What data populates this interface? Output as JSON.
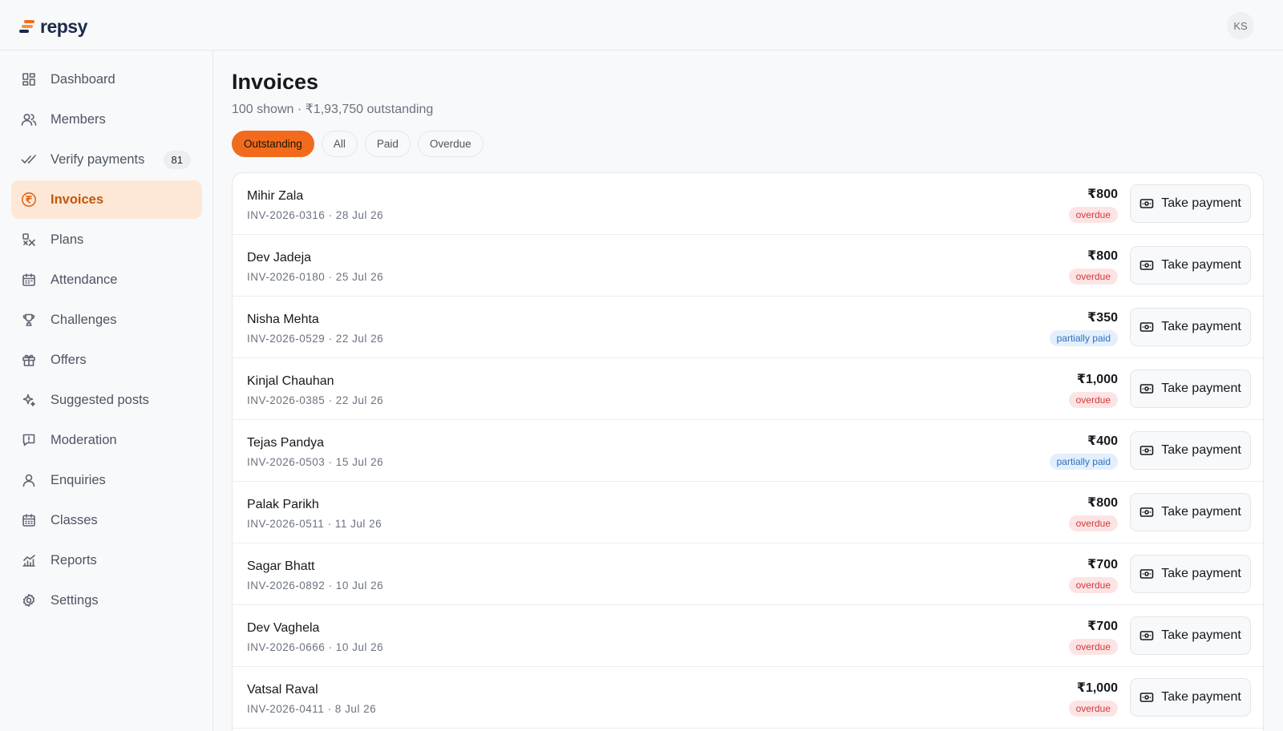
{
  "app": {
    "brand": "repsy",
    "user_initials": "KS"
  },
  "sidebar": {
    "items": [
      {
        "label": "Dashboard",
        "icon": "dashboard-icon"
      },
      {
        "label": "Members",
        "icon": "members-icon"
      },
      {
        "label": "Verify payments",
        "icon": "double-check-icon",
        "badge": "81"
      },
      {
        "label": "Invoices",
        "icon": "rupee-circle-icon",
        "active": true
      },
      {
        "label": "Plans",
        "icon": "plans-icon"
      },
      {
        "label": "Attendance",
        "icon": "calendar-icon"
      },
      {
        "label": "Challenges",
        "icon": "trophy-icon"
      },
      {
        "label": "Offers",
        "icon": "gift-icon"
      },
      {
        "label": "Suggested posts",
        "icon": "sparkles-icon"
      },
      {
        "label": "Moderation",
        "icon": "message-alert-icon"
      },
      {
        "label": "Enquiries",
        "icon": "user-icon"
      },
      {
        "label": "Classes",
        "icon": "calendar-grid-icon"
      },
      {
        "label": "Reports",
        "icon": "chart-icon"
      },
      {
        "label": "Settings",
        "icon": "gear-icon"
      }
    ]
  },
  "page": {
    "title": "Invoices",
    "subtitle": "100 shown · ₹1,93,750 outstanding"
  },
  "filters": [
    "Outstanding",
    "All",
    "Paid",
    "Overdue"
  ],
  "active_filter": "Outstanding",
  "action_label": "Take payment",
  "invoices": [
    {
      "name": "Mihir Zala",
      "meta": "INV-2026-0316 · 28 Jul 26",
      "amount": "₹800",
      "status": "overdue"
    },
    {
      "name": "Dev Jadeja",
      "meta": "INV-2026-0180 · 25 Jul 26",
      "amount": "₹800",
      "status": "overdue"
    },
    {
      "name": "Nisha Mehta",
      "meta": "INV-2026-0529 · 22 Jul 26",
      "amount": "₹350",
      "status": "partially paid"
    },
    {
      "name": "Kinjal Chauhan",
      "meta": "INV-2026-0385 · 22 Jul 26",
      "amount": "₹1,000",
      "status": "overdue"
    },
    {
      "name": "Tejas Pandya",
      "meta": "INV-2026-0503 · 15 Jul 26",
      "amount": "₹400",
      "status": "partially paid"
    },
    {
      "name": "Palak Parikh",
      "meta": "INV-2026-0511 · 11 Jul 26",
      "amount": "₹800",
      "status": "overdue"
    },
    {
      "name": "Sagar Bhatt",
      "meta": "INV-2026-0892 · 10 Jul 26",
      "amount": "₹700",
      "status": "overdue"
    },
    {
      "name": "Dev Vaghela",
      "meta": "INV-2026-0666 · 10 Jul 26",
      "amount": "₹700",
      "status": "overdue"
    },
    {
      "name": "Vatsal Raval",
      "meta": "INV-2026-0411 · 8 Jul 26",
      "amount": "₹1,000",
      "status": "overdue"
    }
  ],
  "colors": {
    "accent": "#f26b1d",
    "active_nav_bg": "#fde8d7",
    "overdue_bg": "#fde4e4",
    "overdue_text": "#d0393b",
    "partial_bg": "#e3effc",
    "partial_text": "#2f6fc0"
  }
}
